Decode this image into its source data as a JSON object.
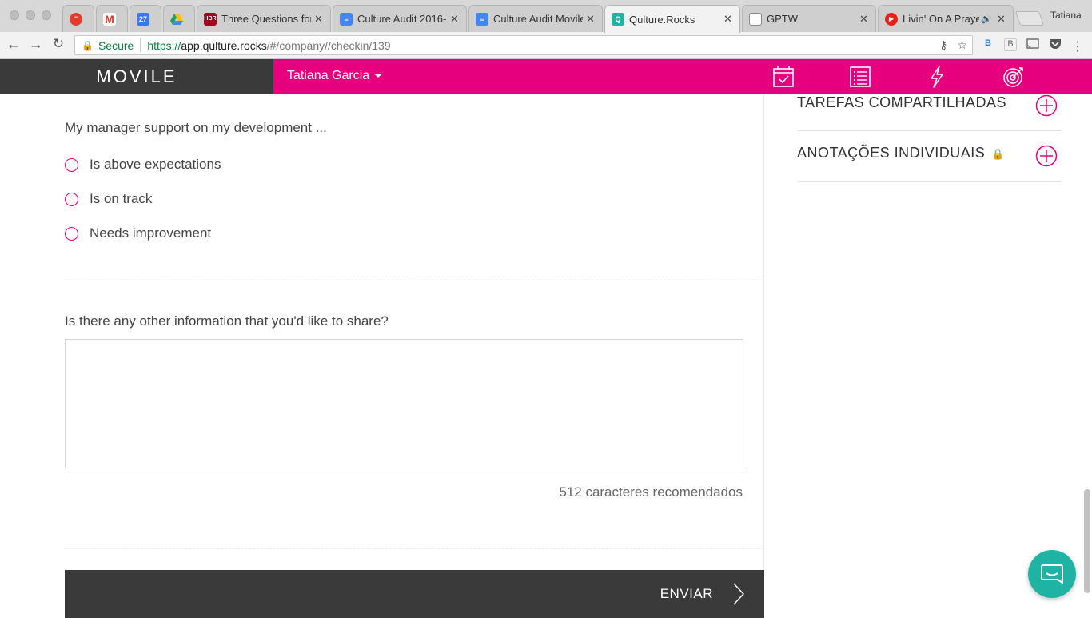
{
  "browser": {
    "tabs": [
      {
        "title": "",
        "favicon": "hangouts-icon"
      },
      {
        "title": "",
        "favicon": "gmail-icon"
      },
      {
        "title": "",
        "favicon": "calendar-icon",
        "badge": "27"
      },
      {
        "title": "",
        "favicon": "drive-icon"
      },
      {
        "title": "Three Questions for",
        "favicon": "hbr-icon",
        "badge": "HBR"
      },
      {
        "title": "Culture Audit 2016-",
        "favicon": "docs-icon"
      },
      {
        "title": "Culture Audit Movile",
        "favicon": "docs-icon"
      },
      {
        "title": "Qulture.Rocks",
        "favicon": "qulture-icon"
      },
      {
        "title": "GPTW",
        "favicon": "page-icon"
      },
      {
        "title": "Livin' On A Prayer",
        "favicon": "youtube-icon"
      }
    ],
    "profile_name": "Tatiana",
    "secure_label": "Secure",
    "url": {
      "scheme": "https://",
      "host": "app.qulture.rocks",
      "path": "/#/company//checkin/139"
    }
  },
  "header": {
    "brand": "MOVILE",
    "user_name": "Tatiana Garcia",
    "accent_color": "#e6007e",
    "icons": [
      "calendar-check-icon",
      "list-icon",
      "lightning-icon",
      "target-icon"
    ]
  },
  "form": {
    "question1": "My manager support on my development ...",
    "options": [
      "Is above expectations",
      "Is on track",
      "Needs improvement"
    ],
    "question2": "Is there any other information that you'd like to share?",
    "textarea_value": "",
    "hint": "512 caracteres recomendados",
    "submit_label": "ENVIAR"
  },
  "sidebar": {
    "sections": [
      {
        "title": "TAREFAS COMPARTILHADAS",
        "locked": false
      },
      {
        "title": "ANOTAÇÕES INDIVIDUAIS",
        "locked": true
      }
    ]
  }
}
